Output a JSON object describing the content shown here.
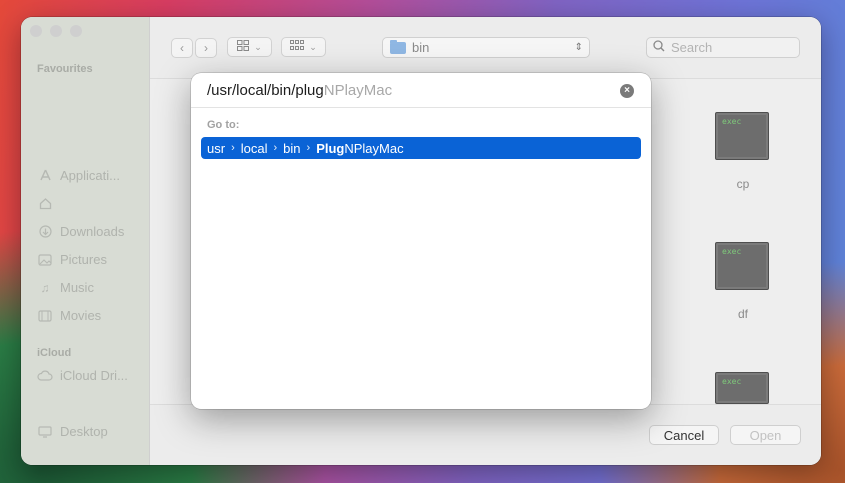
{
  "sidebar": {
    "favourites_header": "Favourites",
    "favourites": [
      {
        "label": "Applicati...",
        "icon": "applications-icon"
      },
      {
        "label": "",
        "icon": "home-icon"
      },
      {
        "label": "Downloads",
        "icon": "downloads-icon"
      },
      {
        "label": "Pictures",
        "icon": "pictures-icon"
      },
      {
        "label": "Music",
        "icon": "music-icon"
      },
      {
        "label": "Movies",
        "icon": "movies-icon"
      }
    ],
    "icloud_header": "iCloud",
    "icloud": [
      {
        "label": "iCloud Dri...",
        "icon": "cloud-icon"
      },
      {
        "label": "Desktop",
        "icon": "desktop-icon"
      }
    ]
  },
  "toolbar": {
    "current_folder": "bin",
    "search_placeholder": "Search"
  },
  "files": [
    {
      "name": "cp",
      "badge": "exec"
    },
    {
      "name": "df",
      "badge": "exec"
    },
    {
      "name": "",
      "badge": "exec"
    }
  ],
  "footer": {
    "cancel_label": "Cancel",
    "open_label": "Open"
  },
  "goto_dialog": {
    "typed_text": "/usr/local/bin/plug",
    "completion_text": "NPlayMac",
    "goto_label": "Go to:",
    "suggestion": {
      "segments": [
        "usr",
        "local",
        "bin"
      ],
      "match_bold": "Plug",
      "match_rest": "NPlayMac"
    }
  },
  "colors": {
    "selection": "#0a63d6",
    "exec_text": "#7ec87a"
  }
}
